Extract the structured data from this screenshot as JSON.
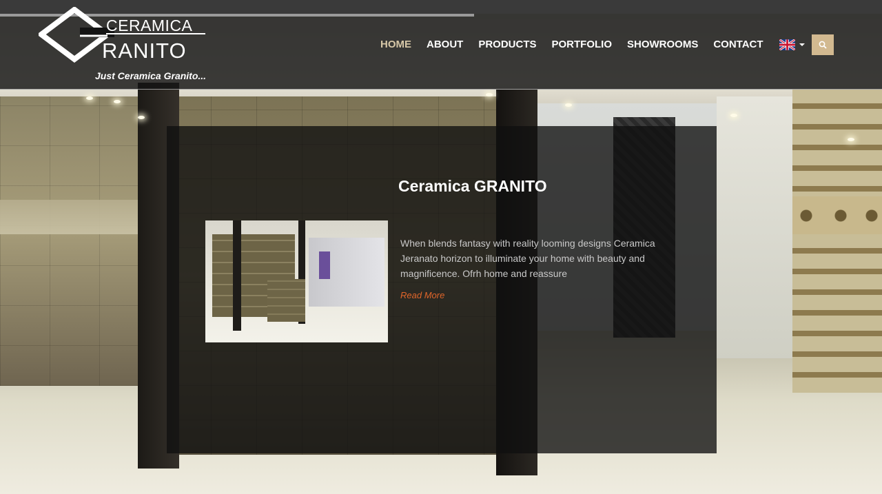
{
  "brand": {
    "logo_top": "CERAMICA",
    "logo_bottom": "RANITO",
    "tagline": "Just Ceramica Granito..."
  },
  "nav": {
    "items": [
      {
        "label": "HOME",
        "active": true
      },
      {
        "label": "ABOUT",
        "active": false
      },
      {
        "label": "PRODUCTS",
        "active": false
      },
      {
        "label": "PORTFOLIO",
        "active": false
      },
      {
        "label": "SHOWROOMS",
        "active": false
      },
      {
        "label": "CONTACT",
        "active": false
      }
    ],
    "language_icon": "uk-flag-icon",
    "search_icon": "search-icon"
  },
  "feature": {
    "title": "Ceramica GRANITO",
    "body": "When blends fantasy with reality looming designs Ceramica Jeranato horizon to illuminate your home with beauty and magnificence. Ofrh home and reassure",
    "link_label": "Read More"
  },
  "colors": {
    "accent": "#d2b990",
    "active_nav": "#d8c8a8",
    "link": "#e0652a",
    "header_bg": "#141414"
  }
}
